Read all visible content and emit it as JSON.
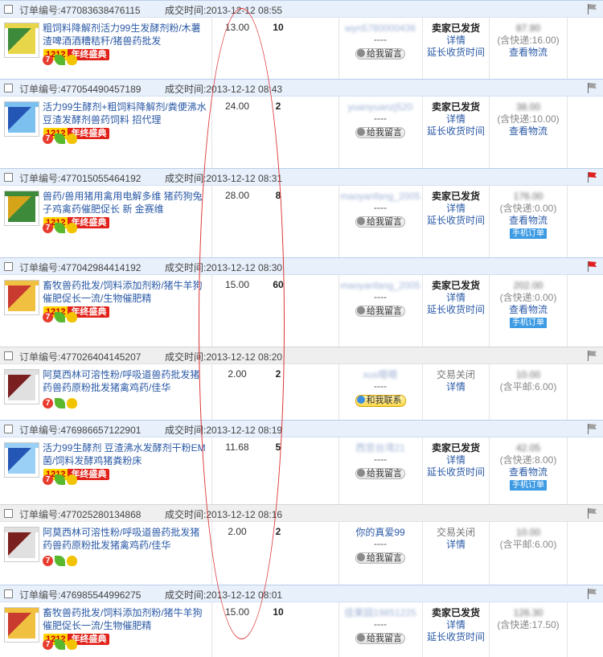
{
  "labels": {
    "order_no": "订单编号:",
    "deal_time": "成交时间:",
    "leave_message": "给我留言",
    "contact_me": "和我联系",
    "details": "详情",
    "extend": "延长收货时间",
    "logistics": "查看物流",
    "mobile_order": "手机订单",
    "dash": "----",
    "badge_num": "1212",
    "badge_text": "年终盛典"
  },
  "colors": {
    "header_blue": "#e8f0fb",
    "header_grey": "#efefef",
    "link_blue": "#2b5aa6",
    "flag_red": "#e02020",
    "annotation_red": "#d33333"
  },
  "orders": [
    {
      "id": "477083638476115",
      "time": "2013-12-12 08:55",
      "header": "blue",
      "flag": "grey",
      "title": "粗饲料降解剂活力99生发酵剂粉/木薯渣啤酒酒糟秸秆/猪兽药批发",
      "badge": true,
      "price": "13.00",
      "qty": "10",
      "buyer": "wyn5780000436",
      "buyer_blurred": true,
      "buyer_button": "message",
      "status": "卖家已发货",
      "status_closed": false,
      "extend": true,
      "total": "87.90",
      "shipping": "(含快递:16.00)",
      "logistics": true,
      "mobile": false
    },
    {
      "id": "477054490457189",
      "time": "2013-12-12 08:43",
      "header": "blue",
      "flag": "grey",
      "title": "活力99生酵剂+粗饲料降解剂/粪便沸水豆渣发酵剂兽药饲料 招代理",
      "badge": true,
      "price": "24.00",
      "qty": "2",
      "buyer": "yuanyuanzj520",
      "buyer_blurred": true,
      "buyer_button": "message",
      "status": "卖家已发货",
      "status_closed": false,
      "extend": true,
      "total": "38.00",
      "shipping": "(含快递:10.00)",
      "logistics": true,
      "mobile": false
    },
    {
      "id": "477015055464192",
      "time": "2013-12-12 08:31",
      "header": "blue",
      "flag": "red",
      "title": "兽药/兽用猪用禽用电解多维 猪药狗兔子鸡禽药催肥促长 新 金赛维",
      "badge": true,
      "price": "28.00",
      "qty": "8",
      "buyer": "maoyanfang_2005",
      "buyer_blurred": true,
      "buyer_button": "message",
      "status": "卖家已发货",
      "status_closed": false,
      "extend": true,
      "total": "176.00",
      "shipping": "(含快递:0.00)",
      "logistics": true,
      "mobile": true
    },
    {
      "id": "477042984414192",
      "time": "2013-12-12 08:30",
      "header": "blue",
      "flag": "red",
      "title": "畜牧兽药批发/饲料添加剂粉/猪牛羊狗催肥促长一流/生物催肥精",
      "badge": true,
      "price": "15.00",
      "qty": "60",
      "buyer": "maoyanfang_2005",
      "buyer_blurred": true,
      "buyer_button": "message",
      "status": "卖家已发货",
      "status_closed": false,
      "extend": true,
      "total": "202.00",
      "shipping": "(含快递:0.00)",
      "logistics": true,
      "mobile": true
    },
    {
      "id": "477026404145207",
      "time": "2013-12-12 08:20",
      "header": "grey",
      "flag": "grey",
      "title": "阿莫西林可溶性粉/呼吸道兽药批发猪药兽药原粉批发猪禽鸡药/佳华",
      "badge": false,
      "price": "2.00",
      "qty": "2",
      "buyer": "xus嗯嗯",
      "buyer_blurred": true,
      "buyer_button": "contact",
      "status": "交易关闭",
      "status_closed": true,
      "extend": false,
      "total": "10.00",
      "shipping": "(含平邮:6.00)",
      "logistics": false,
      "mobile": false
    },
    {
      "id": "476986657122901",
      "time": "2013-12-12 08:19",
      "header": "blue",
      "flag": "grey",
      "title": "活力99生酵剂 豆渣沸水发酵剂干粉EM菌/饲料发酵鸡猪粪粉床",
      "badge": true,
      "price": "11.68",
      "qty": "5",
      "buyer": "西宫台湾21",
      "buyer_blurred": true,
      "buyer_button": "message",
      "status": "卖家已发货",
      "status_closed": false,
      "extend": true,
      "total": "42.05",
      "shipping": "(含快递:8.00)",
      "logistics": true,
      "mobile": true
    },
    {
      "id": "477025280134868",
      "time": "2013-12-12 08:16",
      "header": "grey",
      "flag": "grey",
      "title": "阿莫西林可溶性粉/呼吸道兽药批发猪药兽药原粉批发猪禽鸡药/佳华",
      "badge": false,
      "price": "2.00",
      "qty": "2",
      "buyer": "你的真爱99",
      "buyer_blurred": false,
      "buyer_button": "message",
      "status": "交易关闭",
      "status_closed": true,
      "extend": false,
      "total": "10.00",
      "shipping": "(含平邮:6.00)",
      "logistics": false,
      "mobile": false
    },
    {
      "id": "476985544996275",
      "time": "2013-12-12 08:01",
      "header": "blue",
      "flag": "grey",
      "title": "畜牧兽药批发/饲料添加剂粉/猪牛羊狗催肥促长一流/生物催肥精",
      "badge": true,
      "price": "15.00",
      "qty": "10",
      "buyer": "佳果园19851225",
      "buyer_blurred": true,
      "buyer_button": "message",
      "status": "卖家已发货",
      "status_closed": false,
      "extend": true,
      "total": "126.30",
      "shipping": "(含快递:17.50)",
      "logistics": false,
      "mobile": false
    }
  ]
}
